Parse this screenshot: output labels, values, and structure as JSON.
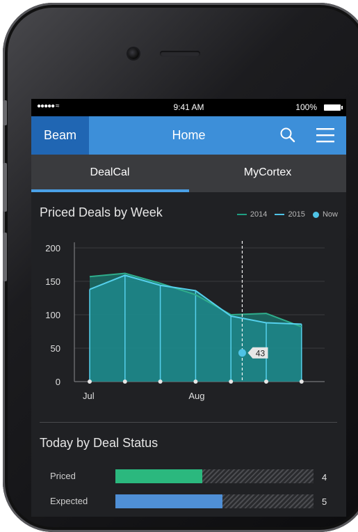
{
  "status_bar": {
    "signal": "●●●●● ≈",
    "time": "9:41 AM",
    "battery": "100%"
  },
  "header": {
    "brand": "Beam",
    "title": "Home",
    "search_icon": "search-icon",
    "menu_icon": "hamburger-menu-icon"
  },
  "tabs": [
    {
      "label": "DealCal",
      "active": true
    },
    {
      "label": "MyCortex",
      "active": false
    }
  ],
  "priced_deals": {
    "title": "Priced Deals by Week",
    "legend": [
      {
        "label": "2014",
        "color": "#1f9e82"
      },
      {
        "label": "2015",
        "color": "#4fc3e6"
      },
      {
        "label": "Now",
        "color": "#4fc3e6"
      }
    ]
  },
  "chart_data": {
    "type": "area",
    "title": "Priced Deals by Week",
    "x": [
      1,
      2,
      3,
      4,
      5,
      6,
      7
    ],
    "x_ticks": [
      {
        "x": 1,
        "label": "Jul"
      },
      {
        "x": 4,
        "label": "Aug"
      }
    ],
    "series": [
      {
        "name": "2014",
        "values": [
          157,
          162,
          147,
          130,
          100,
          102,
          82
        ]
      },
      {
        "name": "2015",
        "values": [
          138,
          159,
          144,
          136,
          98,
          88,
          86
        ]
      }
    ],
    "ylim": [
      0,
      200
    ],
    "y_ticks": [
      0,
      50,
      100,
      150,
      200
    ],
    "now": {
      "x": 5.32,
      "value": 43,
      "label": "43"
    },
    "grid": true
  },
  "deal_status": {
    "title": "Today by Deal Status",
    "bars": [
      {
        "label": "Priced",
        "fraction": 0.44,
        "count": "4",
        "color": "#2bb87e"
      },
      {
        "label": "Expected",
        "fraction": 0.54,
        "count": "5",
        "color": "#4f8fd6"
      }
    ]
  }
}
